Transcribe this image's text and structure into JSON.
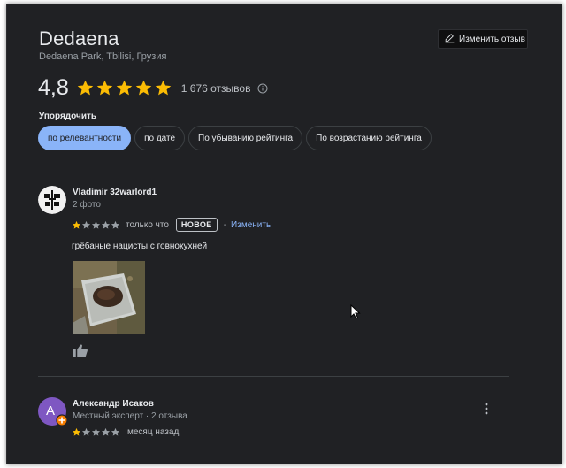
{
  "place": {
    "title": "Dedaena",
    "subtitle": "Dedaena Park, Tbilisi, Грузия",
    "rating": "4,8",
    "review_count": "1 676 отзывов",
    "edit_review_label": "Изменить отзыв"
  },
  "sort": {
    "label": "Упорядочить",
    "chips": [
      {
        "label": "по релевантности",
        "active": true
      },
      {
        "label": "по дате",
        "active": false
      },
      {
        "label": "По убыванию рейтинга",
        "active": false
      },
      {
        "label": "По возрастанию рейтинга",
        "active": false
      }
    ]
  },
  "reviews": [
    {
      "author": "Vladimir 32warlord1",
      "meta": "2 фото",
      "stars": 1,
      "time": "только что",
      "badge": "НОВОЕ",
      "separator": "-",
      "edit_link": "Изменить",
      "text": "грёбаные нацисты с говнокухней"
    },
    {
      "author": "Александр Исаков",
      "meta": "Местный эксперт · 2 отзыва",
      "stars": 1,
      "time": "месяц назад",
      "avatar_letter": "A"
    }
  ],
  "colors": {
    "background": "#202124",
    "star_filled": "#fbbc04",
    "star_empty": "#9aa0a6",
    "accent": "#8ab4f8",
    "avatar_purple": "#7e57c2",
    "avatar_badge": "#f57c00"
  },
  "icons": [
    "pencil-icon",
    "star-icon",
    "info-icon",
    "thumbs-up-icon",
    "more-vert-icon",
    "local-guide-badge-icon",
    "mouse-cursor-icon"
  ]
}
